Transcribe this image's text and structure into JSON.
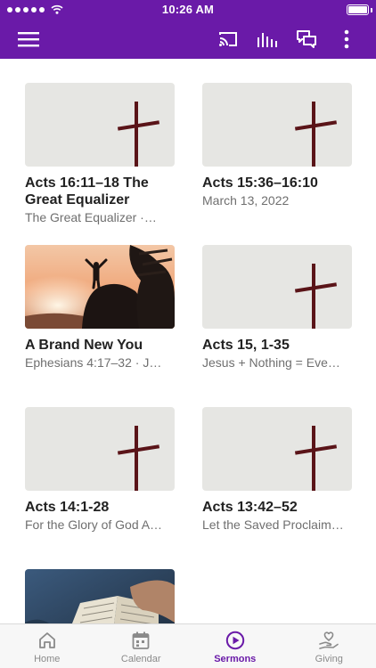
{
  "status_bar": {
    "time": "10:26 AM"
  },
  "sermons": [
    {
      "title": "Acts 16:11–18 The Great Equalizer",
      "subtitle": "The Great Equalizer ·…",
      "image": "cross-icon"
    },
    {
      "title": "Acts 15:36–16:10",
      "subtitle": "March 13, 2022",
      "image": "cross-icon"
    },
    {
      "title": "A Brand New You",
      "subtitle": "Ephesians 4:17–32 · J…",
      "image": "sunset-silhouette-photo"
    },
    {
      "title": "Acts 15, 1-35",
      "subtitle": "Jesus + Nothing = Eve…",
      "image": "cross-icon"
    },
    {
      "title": "Acts 14:1-28",
      "subtitle": "For the Glory of God A…",
      "image": "cross-icon"
    },
    {
      "title": "Acts 13:42–52",
      "subtitle": "Let the Saved Proclaim…",
      "image": "cross-icon"
    },
    {
      "title": "",
      "subtitle": "",
      "image": "open-bible-photo"
    }
  ],
  "tabs": [
    {
      "label": "Home",
      "icon": "home-icon"
    },
    {
      "label": "Calendar",
      "icon": "calendar-icon"
    },
    {
      "label": "Sermons",
      "icon": "play-circle-icon",
      "active": true
    },
    {
      "label": "Giving",
      "icon": "giving-heart-hand-icon"
    }
  ],
  "colors": {
    "accent": "#6a1aa8",
    "cross": "#5a1418",
    "thumb_bg": "#e6e6e3"
  }
}
